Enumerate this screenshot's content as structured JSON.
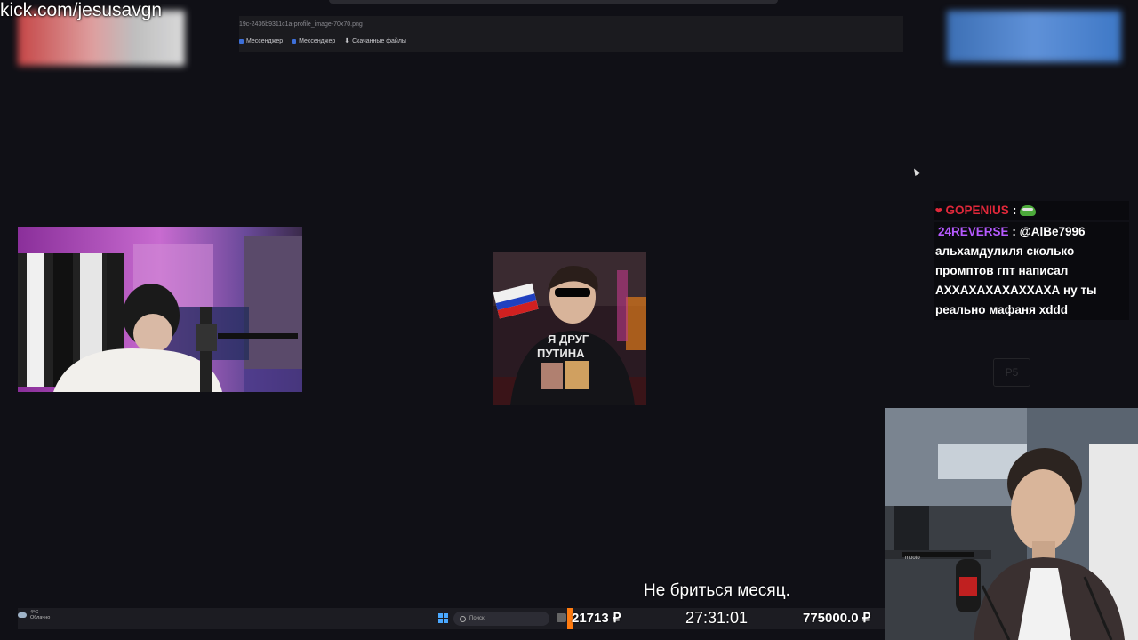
{
  "overlay": {
    "channel_url": "kick.com/jesusavgn"
  },
  "browser": {
    "address_text": "19c-2436b9311c1a-profile_image-70x70.png",
    "bookmarks": [
      {
        "label": "Мессенджер",
        "icon": "messenger-icon"
      },
      {
        "label": "Мессенджер",
        "icon": "messenger-icon"
      },
      {
        "label": "Скачанные файлы",
        "icon": "download-icon"
      }
    ]
  },
  "chat": {
    "messages": [
      {
        "username": "GOPENIUS",
        "separator": ":",
        "emote": "pepe-emote",
        "color": "#e0283a"
      },
      {
        "username": "24REVERSE",
        "separator": ":",
        "text": "@AlBe7996",
        "color": "#b65aff",
        "lines": [
          "альхамдулиля сколько",
          "промптов гпт написал",
          "АХХАХАХАХАХХАХА ну ты",
          "реально мафаня xddd"
        ]
      }
    ]
  },
  "ghost_key_label": "P5",
  "center_image": {
    "shirt_text_1": "Я ДРУГ",
    "shirt_text_2": "ПУТИНА"
  },
  "subtitle": "Не бриться месяц.",
  "taskbar": {
    "weather_temp": "4°C",
    "weather_desc": "Облачно",
    "search_placeholder": "Поиск"
  },
  "stats": {
    "donations_left": "21713 ₽",
    "timer": "27:31:01",
    "goal": "775000.0 ₽"
  },
  "webcam_right_label": "mooto"
}
